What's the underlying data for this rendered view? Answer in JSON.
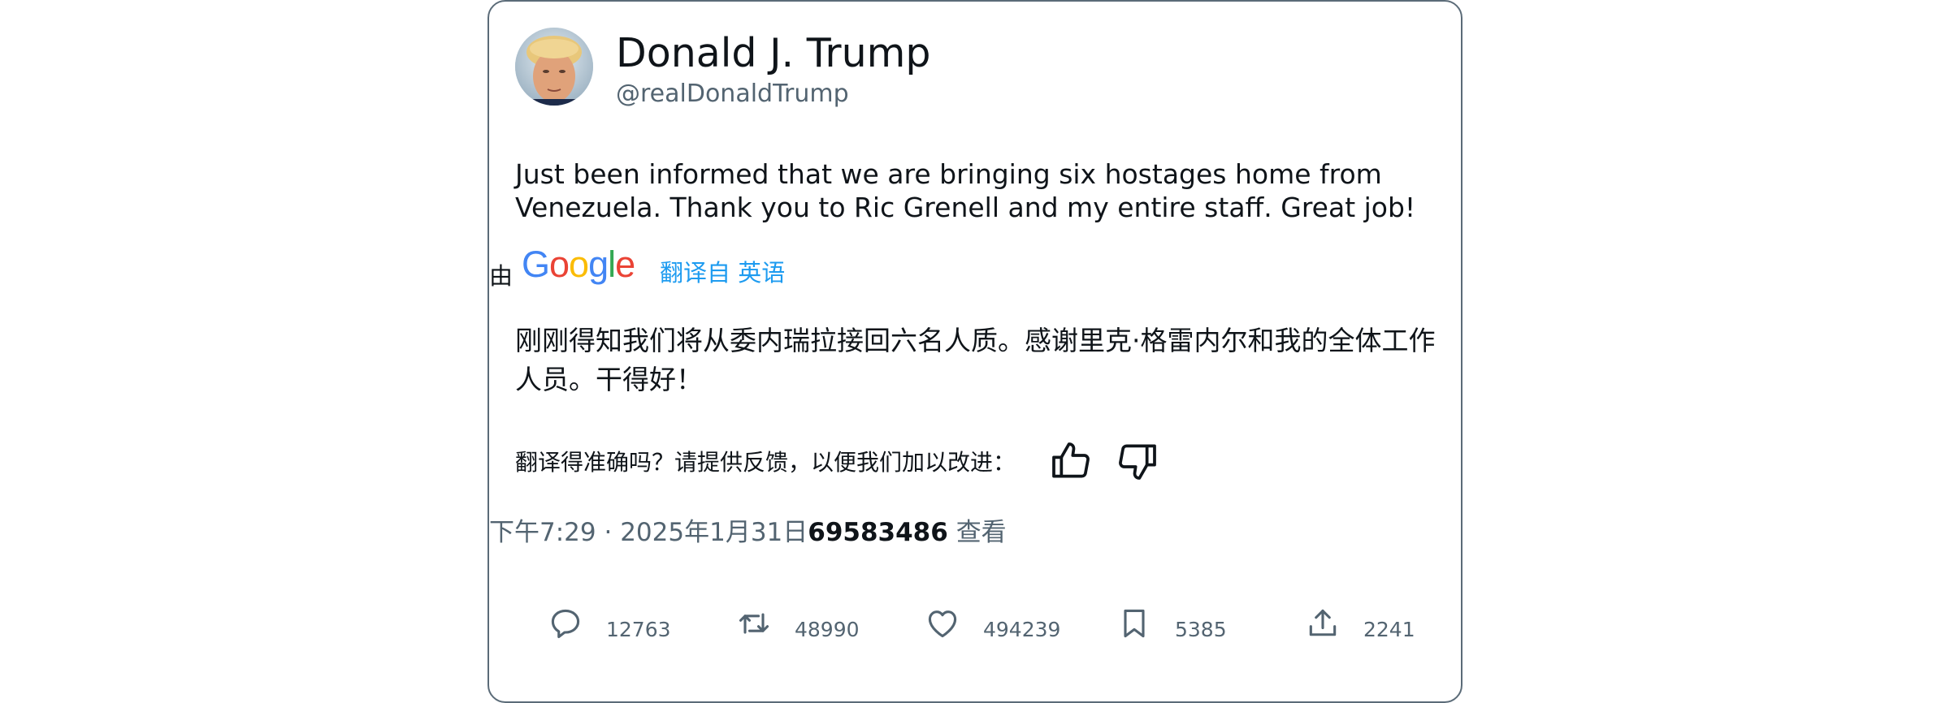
{
  "author": {
    "name": "Donald J. Trump",
    "handle": "@realDonaldTrump"
  },
  "tweet": {
    "text": "Just been informed that we are bringing six hostages home from Venezuela. Thank you to Ric Grenell and my entire staff. Great job!"
  },
  "translation": {
    "by_label": "由",
    "provider_logo_text": "Google",
    "translated_from": "翻译自 英语",
    "translated_text": "刚刚得知我们将从委内瑞拉接回六名人质。感谢里克·格雷内尔和我的全体工作人员。干得好！",
    "feedback_prompt": "翻译得准确吗？请提供反馈，以便我们加以改进："
  },
  "meta": {
    "time": "下午7:29",
    "separator": "·",
    "date": "2025年1月31日",
    "views_count": "69583486",
    "views_label": "查看"
  },
  "actions": {
    "reply_count": "12763",
    "retweet_count": "48990",
    "like_count": "494239",
    "bookmark_count": "5385",
    "share_count": "2241"
  },
  "icons": {
    "reply": "speech-bubble-icon",
    "retweet": "retweet-icon",
    "like": "heart-icon",
    "bookmark": "bookmark-icon",
    "share": "share-upload-icon",
    "thumb_up": "thumbs-up-icon",
    "thumb_down": "thumbs-down-icon"
  },
  "colors": {
    "link": "#1d9bf0",
    "secondary_text": "#536471",
    "primary_text": "#0f1419",
    "card_border": "#5b6b78"
  }
}
